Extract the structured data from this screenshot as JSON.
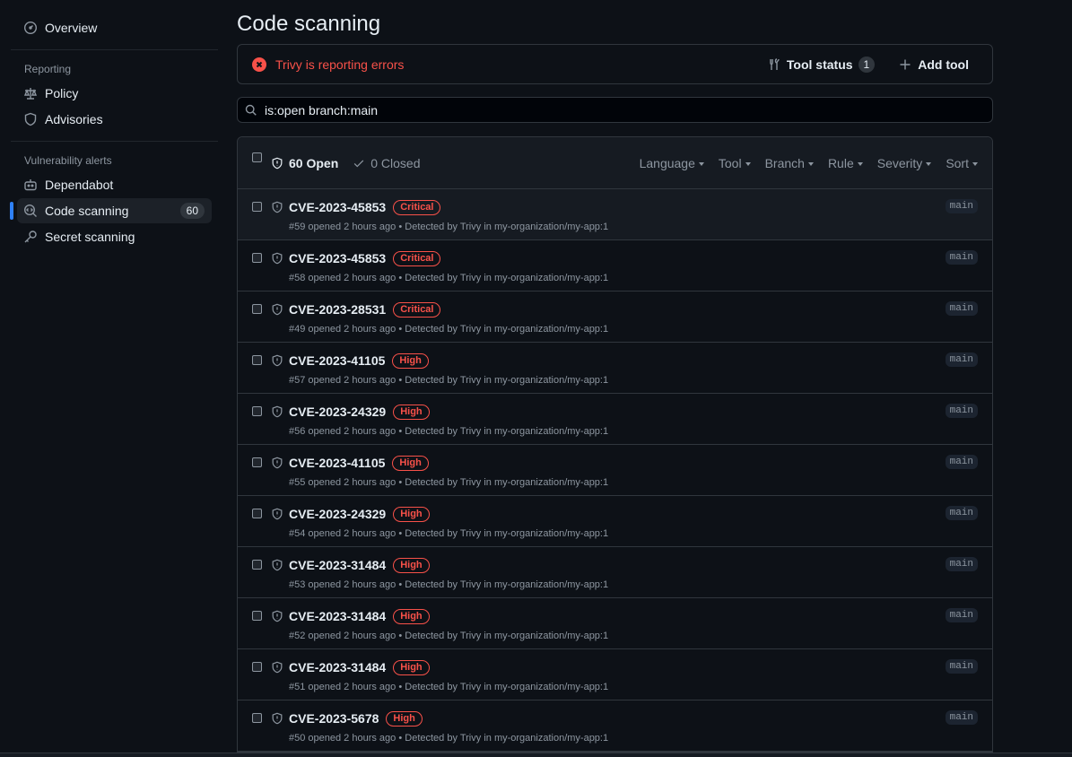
{
  "sidebar": {
    "overview": {
      "label": "Overview",
      "icon": "meter-icon"
    },
    "reporting_title": "Reporting",
    "reporting": [
      {
        "label": "Policy",
        "icon": "law-icon"
      },
      {
        "label": "Advisories",
        "icon": "shield-icon"
      }
    ],
    "vuln_title": "Vulnerability alerts",
    "vuln": [
      {
        "label": "Dependabot",
        "icon": "dependabot-icon"
      },
      {
        "label": "Code scanning",
        "icon": "codescan-icon",
        "count": "60",
        "active": true
      },
      {
        "label": "Secret scanning",
        "icon": "key-icon"
      }
    ]
  },
  "page": {
    "title": "Code scanning"
  },
  "banner": {
    "error_text": "Trivy is reporting errors",
    "tool_status_label": "Tool status",
    "tool_status_count": "1",
    "add_tool_label": "Add tool"
  },
  "search": {
    "value": "is:open branch:main"
  },
  "list_header": {
    "open_label": "60 Open",
    "closed_label": "0 Closed",
    "filters": [
      "Language",
      "Tool",
      "Branch",
      "Rule",
      "Severity",
      "Sort"
    ]
  },
  "alerts": [
    {
      "title": "CVE-2023-45853",
      "severity": "Critical",
      "number": "#59",
      "opened": "opened 2 hours ago",
      "detected_prefix": "• Detected by",
      "tool": "Trivy",
      "in": "in",
      "location": "my-organization/my-app:1",
      "branch": "main"
    },
    {
      "title": "CVE-2023-45853",
      "severity": "Critical",
      "number": "#58",
      "opened": "opened 2 hours ago",
      "detected_prefix": "• Detected by",
      "tool": "Trivy",
      "in": "in",
      "location": "my-organization/my-app:1",
      "branch": "main"
    },
    {
      "title": "CVE-2023-28531",
      "severity": "Critical",
      "number": "#49",
      "opened": "opened 2 hours ago",
      "detected_prefix": "• Detected by",
      "tool": "Trivy",
      "in": "in",
      "location": "my-organization/my-app:1",
      "branch": "main"
    },
    {
      "title": "CVE-2023-41105",
      "severity": "High",
      "number": "#57",
      "opened": "opened 2 hours ago",
      "detected_prefix": "• Detected by",
      "tool": "Trivy",
      "in": "in",
      "location": "my-organization/my-app:1",
      "branch": "main"
    },
    {
      "title": "CVE-2023-24329",
      "severity": "High",
      "number": "#56",
      "opened": "opened 2 hours ago",
      "detected_prefix": "• Detected by",
      "tool": "Trivy",
      "in": "in",
      "location": "my-organization/my-app:1",
      "branch": "main"
    },
    {
      "title": "CVE-2023-41105",
      "severity": "High",
      "number": "#55",
      "opened": "opened 2 hours ago",
      "detected_prefix": "• Detected by",
      "tool": "Trivy",
      "in": "in",
      "location": "my-organization/my-app:1",
      "branch": "main"
    },
    {
      "title": "CVE-2023-24329",
      "severity": "High",
      "number": "#54",
      "opened": "opened 2 hours ago",
      "detected_prefix": "• Detected by",
      "tool": "Trivy",
      "in": "in",
      "location": "my-organization/my-app:1",
      "branch": "main"
    },
    {
      "title": "CVE-2023-31484",
      "severity": "High",
      "number": "#53",
      "opened": "opened 2 hours ago",
      "detected_prefix": "• Detected by",
      "tool": "Trivy",
      "in": "in",
      "location": "my-organization/my-app:1",
      "branch": "main"
    },
    {
      "title": "CVE-2023-31484",
      "severity": "High",
      "number": "#52",
      "opened": "opened 2 hours ago",
      "detected_prefix": "• Detected by",
      "tool": "Trivy",
      "in": "in",
      "location": "my-organization/my-app:1",
      "branch": "main"
    },
    {
      "title": "CVE-2023-31484",
      "severity": "High",
      "number": "#51",
      "opened": "opened 2 hours ago",
      "detected_prefix": "• Detected by",
      "tool": "Trivy",
      "in": "in",
      "location": "my-organization/my-app:1",
      "branch": "main"
    },
    {
      "title": "CVE-2023-5678",
      "severity": "High",
      "number": "#50",
      "opened": "opened 2 hours ago",
      "detected_prefix": "• Detected by",
      "tool": "Trivy",
      "in": "in",
      "location": "my-organization/my-app:1",
      "branch": "main"
    }
  ],
  "colors": {
    "accent": "#2f81f7",
    "danger": "#f85149",
    "background": "#0d1117"
  }
}
